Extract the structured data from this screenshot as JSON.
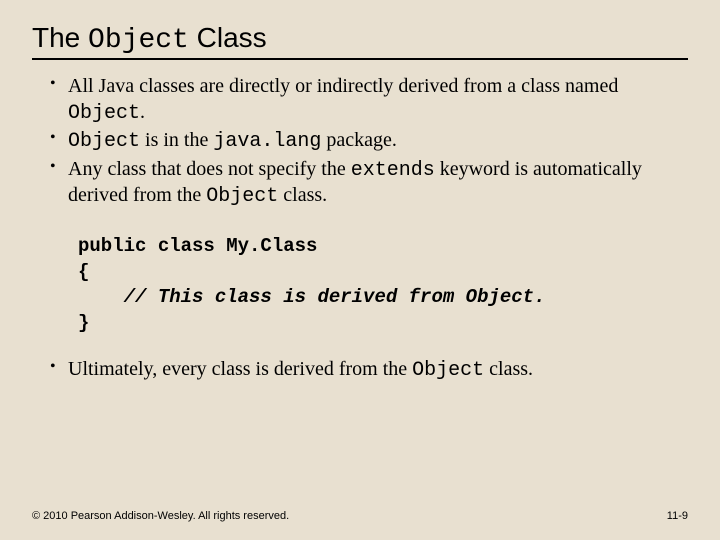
{
  "title_part1": "The ",
  "title_code": "Object",
  "title_part2": " Class",
  "bullets": {
    "b1_a": "All Java classes are directly or indirectly derived from a class named ",
    "b1_code": "Object",
    "b1_b": ".",
    "b2_code1": "Object",
    "b2_a": " is in the ",
    "b2_code2": "java.lang",
    "b2_b": " package.",
    "b3_a": "Any class that does not specify the ",
    "b3_code1": "extends",
    "b3_b": " keyword is automatically derived from the ",
    "b3_code2": "Object",
    "b3_c": " class.",
    "b4_a": "Ultimately, every class is derived from the ",
    "b4_code": "Object",
    "b4_b": " class."
  },
  "code": {
    "line1": "public class My.Class",
    "line2": "{",
    "line3": "    // This class is derived from Object.",
    "line4": "}"
  },
  "footer": {
    "copyright": "© 2010 Pearson Addison-Wesley. All rights reserved.",
    "page": "11-9"
  }
}
